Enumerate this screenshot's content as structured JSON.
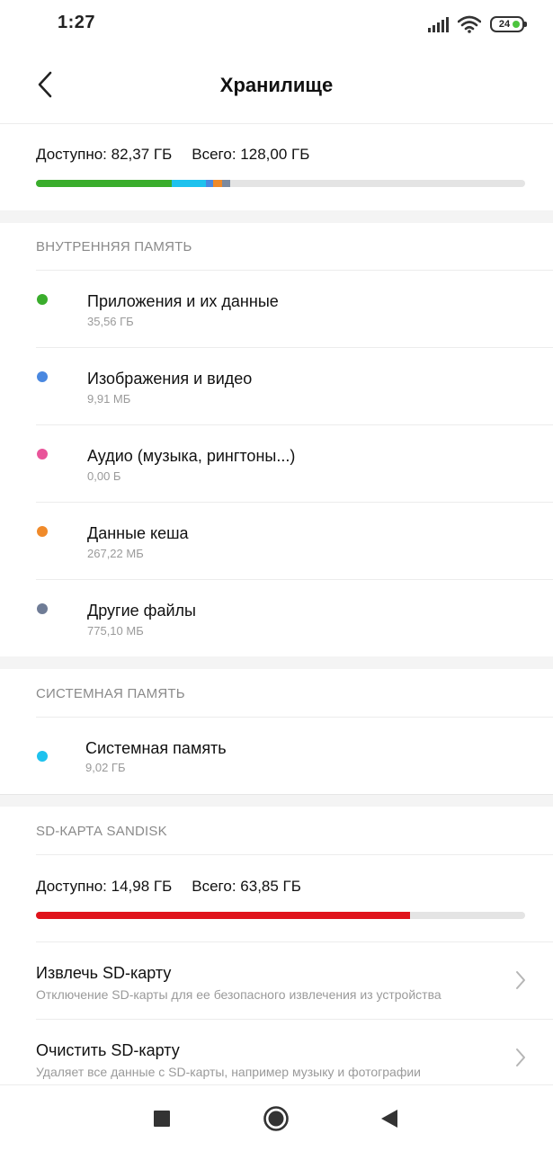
{
  "status_bar": {
    "time": "1:27",
    "battery_level": "24",
    "icons": [
      "signal-icon",
      "wifi-icon",
      "battery-icon"
    ]
  },
  "header": {
    "title": "Хранилище",
    "back_icon": "back-arrow-icon"
  },
  "internal_summary": {
    "available": "Доступно: 82,37 ГБ",
    "total": "Всего: 128,00 ГБ",
    "usage_segments": [
      {
        "name": "apps",
        "color": "#3aad2c",
        "fraction": 0.278
      },
      {
        "name": "system",
        "color": "#1ec2ee",
        "fraction": 0.07
      },
      {
        "name": "images",
        "color": "#4a88e0",
        "fraction": 0.015
      },
      {
        "name": "cache",
        "color": "#f08a2a",
        "fraction": 0.018
      },
      {
        "name": "other",
        "color": "#7b8aa0",
        "fraction": 0.016
      }
    ]
  },
  "internal_section": {
    "label": "ВНУТРЕННЯЯ ПАМЯТЬ",
    "items": [
      {
        "label": "Приложения и их данные",
        "size": "35,56 ГБ",
        "color": "#3aad2c"
      },
      {
        "label": "Изображения и видео",
        "size": "9,91 МБ",
        "color": "#4a88e0"
      },
      {
        "label": "Аудио (музыка, рингтоны...)",
        "size": "0,00 Б",
        "color": "#e9549a"
      },
      {
        "label": "Данные кеша",
        "size": "267,22 МБ",
        "color": "#f08a2a"
      },
      {
        "label": "Другие файлы",
        "size": "775,10 МБ",
        "color": "#6f7c96"
      }
    ]
  },
  "system_section": {
    "label": "СИСТЕМНАЯ ПАМЯТЬ",
    "item": {
      "label": "Системная память",
      "size": "9,02 ГБ",
      "color": "#1ec2ee"
    }
  },
  "sd_section": {
    "label": "SD-КАРТА SANDISK",
    "available": "Доступно: 14,98 ГБ",
    "total": "Всего: 63,85 ГБ",
    "used_fraction": 0.765,
    "used_color": "#e0131b",
    "actions": [
      {
        "label": "Извлечь SD-карту",
        "description": "Отключение SD-карты для ее безопасного извлечения из устройства"
      },
      {
        "label": "Очистить SD-карту",
        "description": "Удаляет все данные с SD-карты, например музыку и фотографии"
      }
    ]
  },
  "nav_bar": {
    "buttons": [
      "recents-square-icon",
      "home-circle-icon",
      "back-triangle-icon"
    ]
  }
}
